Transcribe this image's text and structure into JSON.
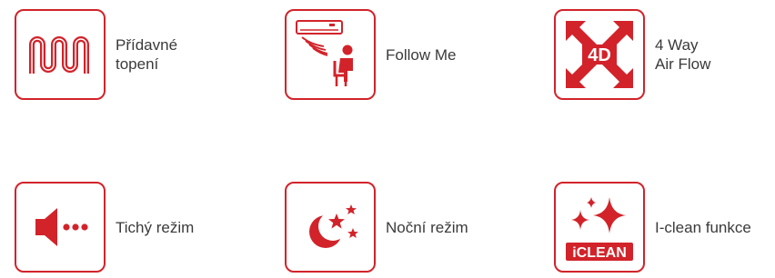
{
  "colors": {
    "accent": "#d2232a",
    "text": "#3a3a3a",
    "background": "#ffffff"
  },
  "features": [
    {
      "icon": "heater-coil-icon",
      "label": "Přídavné\ntopení"
    },
    {
      "icon": "follow-me-icon",
      "label": "Follow Me"
    },
    {
      "icon": "4d-airflow-icon",
      "label": "4 Way\nAir Flow",
      "icon_text": "4D"
    },
    {
      "icon": "speaker-quiet-icon",
      "label": "Tichý režim"
    },
    {
      "icon": "moon-stars-icon",
      "label": "Noční režim"
    },
    {
      "icon": "iclean-sparkle-icon",
      "label": "I-clean funkce",
      "icon_text": "iCLEAN"
    }
  ]
}
